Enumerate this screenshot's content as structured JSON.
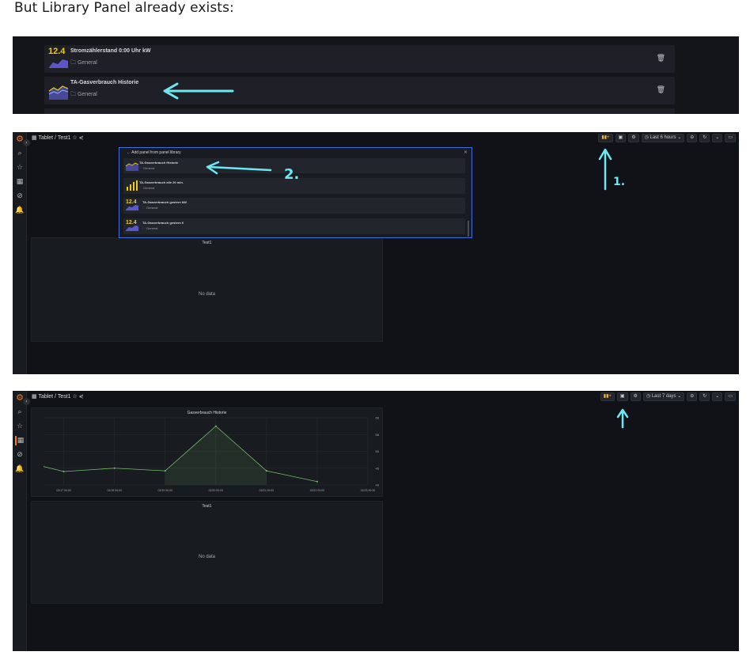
{
  "caption": "But Library Panel already exists:",
  "library_list": {
    "rows": [
      {
        "value": "12.4",
        "name": "Stromzählerstand 0:00 Uhr kW",
        "folder": "General"
      },
      {
        "value": "",
        "name": "TA-Gasverbrauch Historie",
        "folder": "General"
      }
    ],
    "trash_icon": "trash-icon"
  },
  "dashboard": {
    "breadcrumb": "Tablet / Test1",
    "time_range_1": "Last 6 hours",
    "time_range_2": "Last 7 days",
    "panel_title": "Test1",
    "no_data": "No data"
  },
  "modal": {
    "title": "Add panel from panel library",
    "rows": [
      {
        "value": "",
        "name": "TA-Gasverbrauch Historie",
        "folder": "General"
      },
      {
        "value": "",
        "name": "TA-Gasverbrauch alle 20 min.",
        "folder": "General"
      },
      {
        "value": "12.4",
        "name": "TA-Gasverbrauch gestern kW",
        "folder": "General"
      },
      {
        "value": "12.4",
        "name": "TA-Gasverbrauch gestern €",
        "folder": "General"
      }
    ]
  },
  "annotations": {
    "label_1": "1.",
    "label_2": "2."
  },
  "gas_panel": {
    "title": "Gasverbrauch Historie"
  },
  "chart_data": {
    "type": "line",
    "title": "Gasverbrauch Historie",
    "x_ticks": [
      "02/17 00:00",
      "02/18 00:00",
      "02/19 00:00",
      "02/20 00:00",
      "02/21 00:00",
      "02/22 00:00",
      "02/23 00:00"
    ],
    "y_ticks": [
      40,
      45,
      50,
      55,
      60
    ],
    "ylim": [
      40,
      60
    ],
    "series": [
      {
        "x": [
          -0.4,
          0,
          1,
          2,
          3,
          4,
          5
        ],
        "values": [
          45.5,
          44,
          45,
          44.2,
          57.5,
          44.2,
          41
        ]
      }
    ],
    "color": "#73bf69",
    "grid": true
  }
}
